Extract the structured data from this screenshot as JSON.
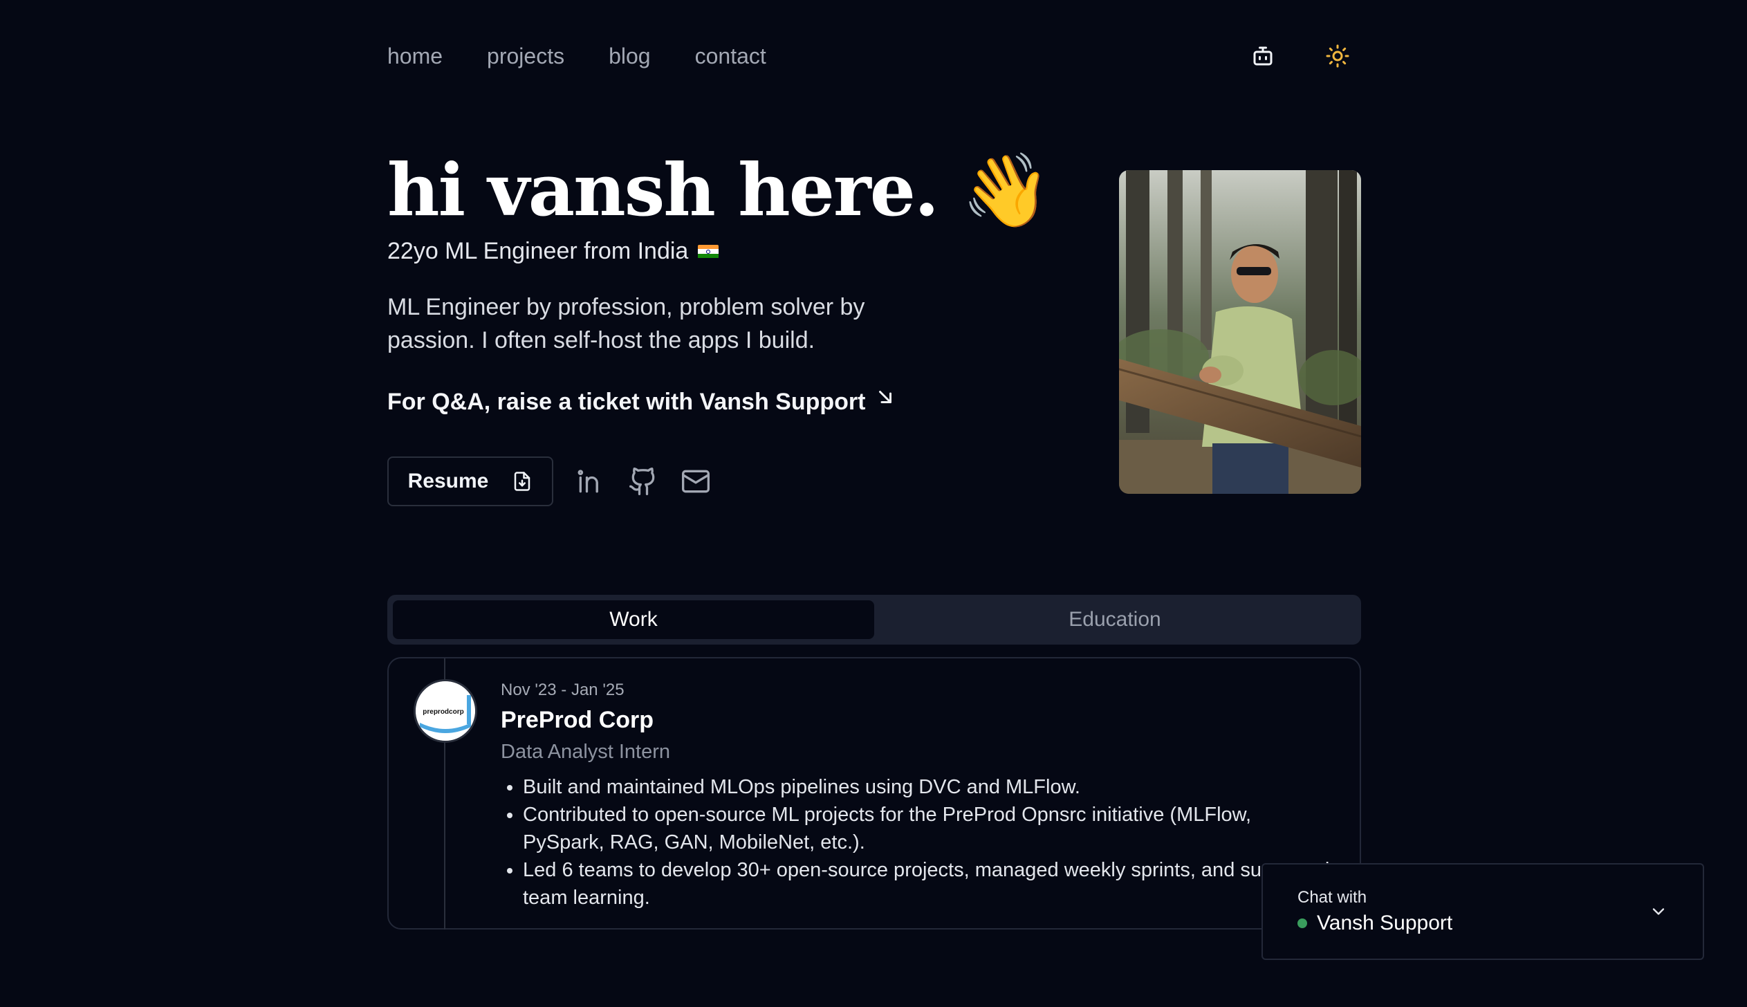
{
  "nav": {
    "links": [
      "home",
      "projects",
      "blog",
      "contact"
    ],
    "icons": [
      "bot-icon",
      "sun-icon"
    ]
  },
  "hero": {
    "title": "hi vansh here.",
    "wave_emoji": "👋",
    "subtitle": "22yo ML Engineer from India",
    "flag": "india-flag",
    "bio": "ML Engineer by profession, problem solver by passion. I often self-host the apps I build.",
    "qa_text": "For Q&A, raise a ticket with Vansh Support",
    "resume_label": "Resume",
    "social_icons": [
      "linkedin-icon",
      "github-icon",
      "mail-icon"
    ]
  },
  "tabs": {
    "items": [
      "Work",
      "Education"
    ],
    "active": "Work"
  },
  "experience": [
    {
      "dates": "Nov '23 - Jan '25",
      "company": "PreProd Corp",
      "logo_text": "preprodcorp",
      "role": "Data Analyst Intern",
      "bullets": [
        "Built and maintained MLOps pipelines using DVC and MLFlow.",
        "Contributed to open-source ML projects for the PreProd Opnsrc initiative (MLFlow, PySpark, RAG, GAN, MobileNet, etc.).",
        "Led 6 teams to develop 30+ open-source projects, managed weekly sprints, and supported team learning."
      ]
    }
  ],
  "chat": {
    "label": "Chat with",
    "name": "Vansh Support",
    "status_color": "#3a9d5d"
  },
  "colors": {
    "background": "#050814",
    "text": "#f2f4f8",
    "muted": "#a3a8b4",
    "tabs_bg": "#1b2030",
    "border": "#232838",
    "sun_accent": "#f0b63f"
  }
}
